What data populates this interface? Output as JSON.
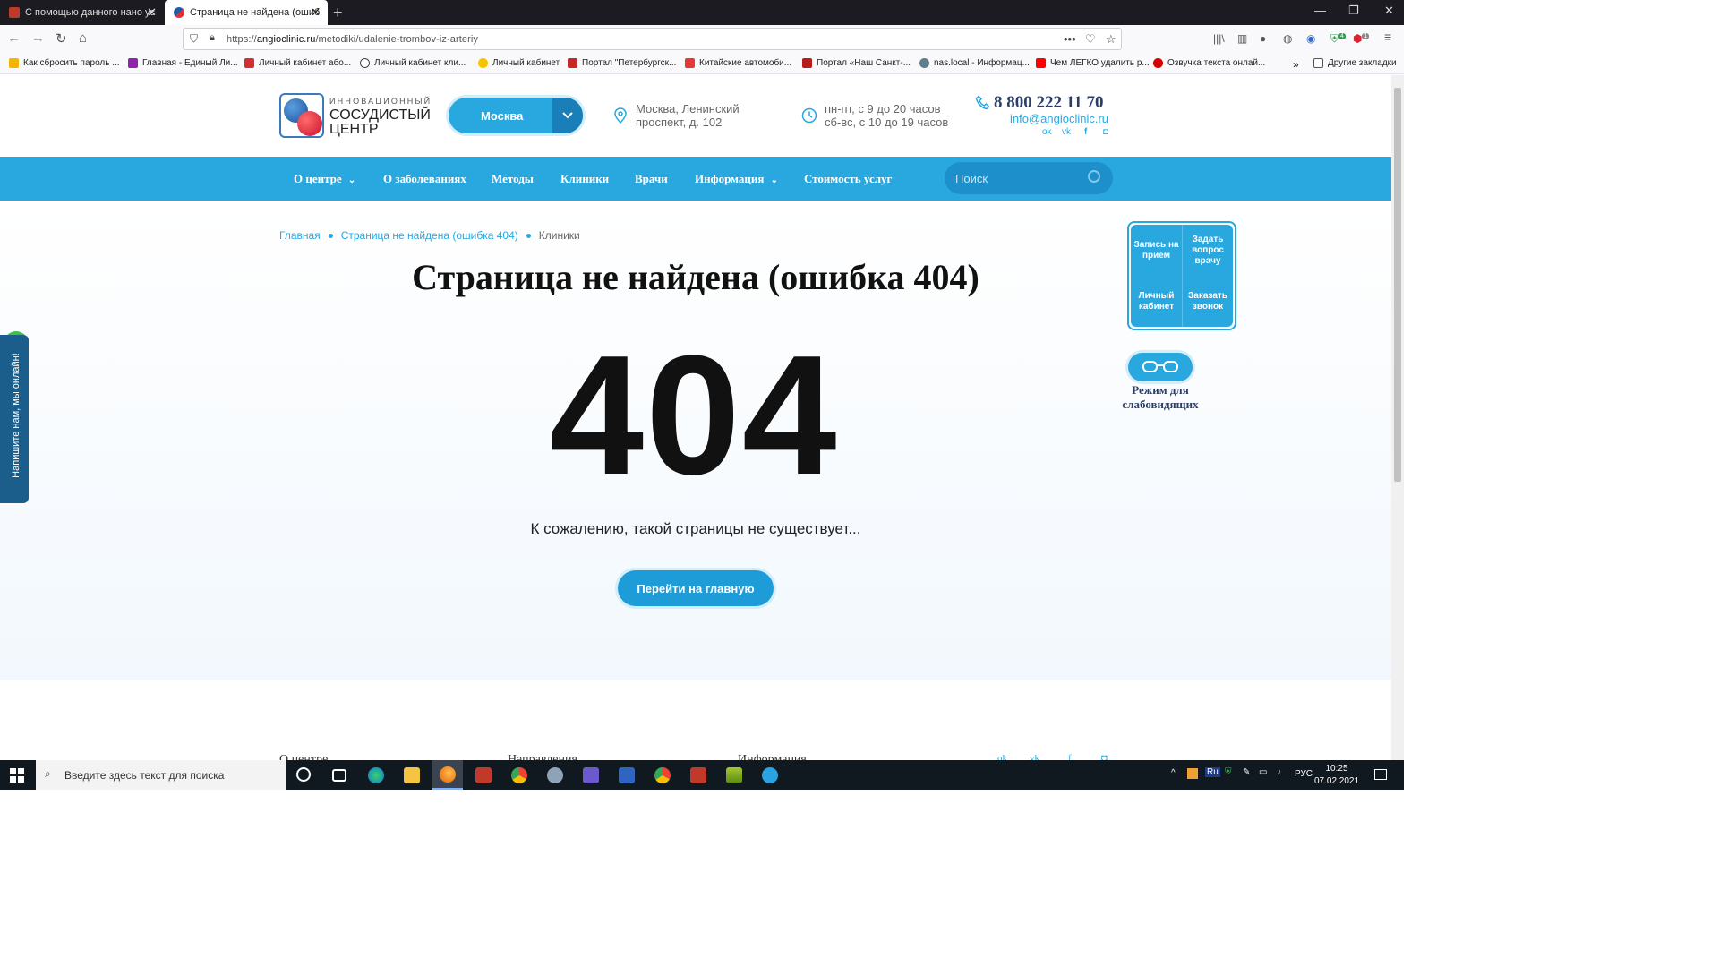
{
  "browser": {
    "tabs": [
      {
        "title": "С помощью данного нано ус"
      },
      {
        "title": "Страница не найдена (ошибк"
      }
    ],
    "url": "https://angioclinic.ru/metodiki/udalenie-trombov-iz-arteriy",
    "url_prefix": "https://",
    "url_domain": "angioclinic.ru",
    "url_path": "/metodiki/udalenie-trombov-iz-arteriy",
    "bookmarks": [
      "Как сбросить пароль ...",
      "Главная - Единый Ли...",
      "Личный кабинет або...",
      "Личный кабинет кли...",
      "Личный кабинет",
      "Портал \"Петербургск...",
      "Китайские автомоби...",
      "Портал «Наш Санкт-...",
      "nas.local - Информац...",
      "Чем ЛЕГКО удалить р...",
      "Озвучка текста онлай..."
    ],
    "other_bookmarks": "Другие закладки",
    "badges": {
      "ext1": "4",
      "ext2": "1"
    }
  },
  "header": {
    "logo_small": "ИННОВАЦИОННЫЙ",
    "logo_line1": "СОСУДИСТЫЙ",
    "logo_line2": "ЦЕНТР",
    "city": "Москва",
    "address_line1": "Москва, Ленинский",
    "address_line2": "проспект, д. 102",
    "hours_line1": "пн-пт, с 9 до 20 часов",
    "hours_line2": "сб-вс, с 10 до 19 часов",
    "phone": "8 800 222 11 70",
    "email": "info@angioclinic.ru"
  },
  "menu": {
    "items": [
      "О центре",
      "О заболеваниях",
      "Методы",
      "Клиники",
      "Врачи",
      "Информация",
      "Стоимость услуг"
    ],
    "search_placeholder": "Поиск"
  },
  "breadcrumbs": [
    "Главная",
    "Страница не найдена (ошибка 404)",
    "Клиники"
  ],
  "error": {
    "title": "Страница не найдена (ошибка 404)",
    "code": "404",
    "message": "К сожалению, такой страницы не существует...",
    "home_button": "Перейти на главную"
  },
  "widget": {
    "appointment": "Запись на прием",
    "ask": "Задать вопрос врачу",
    "cabinet": "Личный кабинет",
    "callback": "Заказать звонок",
    "low_vision": "Режим для слабовидящих"
  },
  "chat": {
    "label": "Напишите нам, мы онлайн!"
  },
  "footer": {
    "col1": "О центре",
    "col2": "Направления",
    "col3": "Информация"
  },
  "taskbar": {
    "search_placeholder": "Введите здесь текст для поиска",
    "lang_indicator": "Ru",
    "lang": "РУС",
    "time": "10:25",
    "date": "07.02.2021"
  },
  "colors": {
    "accent": "#29a8e0",
    "accent_dark": "#1d8fcb",
    "navy": "#2c3e66"
  }
}
